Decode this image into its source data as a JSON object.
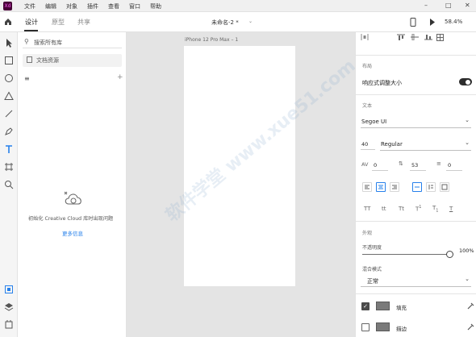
{
  "app": {
    "logo": "Xd",
    "doc_title": "未命名-2 *",
    "zoom": "58.4%"
  },
  "menu": [
    "文件",
    "编辑",
    "对象",
    "插件",
    "查看",
    "窗口",
    "帮助"
  ],
  "tabs": [
    "设计",
    "原型",
    "共享"
  ],
  "library": {
    "search_placeholder": "搜索所有库",
    "doc_assets": "文档资源",
    "empty_message": "初始化 Creative Cloud 库时出现问题",
    "more_info": "更多信息"
  },
  "artboard": {
    "label": "iPhone 12 Pro Max – 1"
  },
  "props": {
    "layout_title": "布局",
    "responsive_resize": "响应式调整大小",
    "responsive_on": true,
    "text_title": "文本",
    "font_family": "Segoe UI",
    "font_size": "40",
    "font_weight": "Regular",
    "char_spacing": "0",
    "line_spacing": "53",
    "para_spacing": "0",
    "appearance_title": "外观",
    "opacity_label": "不透明度",
    "opacity_value": "100%",
    "opacity_fraction": 1.0,
    "blend_label": "混合模式",
    "blend_value": "正常",
    "fill_label": "填充",
    "fill_checked": true,
    "fill_color": "#7a7a7a",
    "border_label": "描边",
    "border_checked": false
  },
  "watermark": "软件学堂  www.xue51.com",
  "colors": {
    "accent": "#2680eb",
    "toggle": "#2c2c2c"
  }
}
